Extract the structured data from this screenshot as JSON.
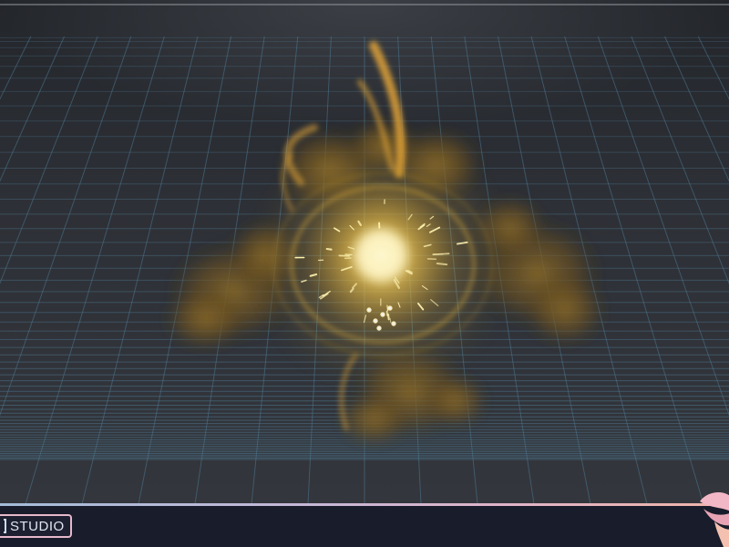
{
  "branding": {
    "studio_label": "STUDIO"
  },
  "scene": {
    "floor_color": "#2b2e33",
    "grid_color": "#4f7891",
    "effect_core_color": "#fff4b8",
    "effect_glow_color": "#f0c040",
    "effect_smoke_color": "#7a5a1e",
    "effect_flame_color": "#e8a838"
  },
  "colors": {
    "bottom_bar": "#191c2a",
    "badge_border": "#e6b8cc",
    "gradient_start": "#a4bcd8",
    "gradient_end": "#f0b4a8"
  },
  "icons": {
    "logo": "studio-logo-icon"
  }
}
